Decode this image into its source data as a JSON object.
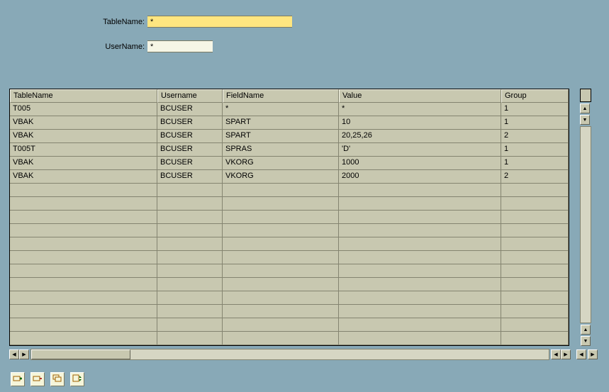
{
  "form": {
    "tablename_label": "TableName:",
    "tablename_value": "*",
    "username_label": "UserName:",
    "username_value": "*"
  },
  "table": {
    "headers": [
      "TableName",
      "Username",
      "FieldName",
      "Value",
      "Group"
    ],
    "rows": [
      {
        "c": [
          "T005",
          "BCUSER",
          "*",
          "*",
          "1"
        ]
      },
      {
        "c": [
          "VBAK",
          "BCUSER",
          "SPART",
          "10",
          "1"
        ]
      },
      {
        "c": [
          "VBAK",
          "BCUSER",
          "SPART",
          "20,25,26",
          "2"
        ]
      },
      {
        "c": [
          "T005T",
          "BCUSER",
          "SPRAS",
          "'D'",
          "1"
        ]
      },
      {
        "c": [
          "VBAK",
          "BCUSER",
          "VKORG",
          "1000",
          "1"
        ]
      },
      {
        "c": [
          "VBAK",
          "BCUSER",
          "VKORG",
          "2000",
          "2"
        ]
      },
      {
        "c": [
          "",
          "",
          "",
          "",
          ""
        ]
      },
      {
        "c": [
          "",
          "",
          "",
          "",
          ""
        ]
      },
      {
        "c": [
          "",
          "",
          "",
          "",
          ""
        ]
      },
      {
        "c": [
          "",
          "",
          "",
          "",
          ""
        ]
      },
      {
        "c": [
          "",
          "",
          "",
          "",
          ""
        ]
      },
      {
        "c": [
          "",
          "",
          "",
          "",
          ""
        ]
      },
      {
        "c": [
          "",
          "",
          "",
          "",
          ""
        ]
      },
      {
        "c": [
          "",
          "",
          "",
          "",
          ""
        ]
      },
      {
        "c": [
          "",
          "",
          "",
          "",
          ""
        ]
      },
      {
        "c": [
          "",
          "",
          "",
          "",
          ""
        ]
      },
      {
        "c": [
          "",
          "",
          "",
          "",
          ""
        ]
      },
      {
        "c": [
          "",
          "",
          "",
          "",
          ""
        ]
      }
    ]
  },
  "icons": {
    "insert_row": "insert-row-icon",
    "delete_row": "delete-row-icon",
    "copy_row": "copy-row-icon",
    "sort": "sort-icon"
  }
}
